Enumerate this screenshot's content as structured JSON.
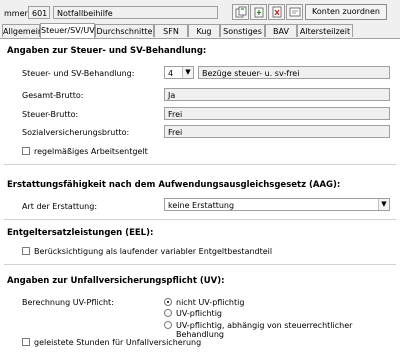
{
  "header": {
    "number_label": "mmer:",
    "number_value": "601",
    "name_value": "Notfallbeihilfe",
    "assign_button": "Konten zuordnen"
  },
  "toolbar": {
    "icons": [
      "copy-icon",
      "paste-icon",
      "delete-icon",
      "info-icon"
    ]
  },
  "tabs": [
    {
      "label": "Allgemein"
    },
    {
      "label": "Steuer/SV/UV"
    },
    {
      "label": "Durchschnitte"
    },
    {
      "label": "SFN"
    },
    {
      "label": "Kug"
    },
    {
      "label": "Sonstiges"
    },
    {
      "label": "BAV"
    },
    {
      "label": "Altersteilzeit"
    }
  ],
  "section_tax": {
    "title": "Angaben zur Steuer- und SV-Behandlung:",
    "treatment_label": "Steuer- und SV-Behandlung:",
    "treatment_code": "4",
    "treatment_text": "Bezüge steuer- u. sv-frei",
    "gross_label": "Gesamt-Brutto:",
    "gross_value": "Ja",
    "tax_gross_label": "Steuer-Brutto:",
    "tax_gross_value": "Frei",
    "sv_gross_label": "Sozialversicherungsbrutto:",
    "sv_gross_value": "Frei",
    "regular_pay_label": "regelmäßiges Arbeitsentgelt"
  },
  "section_aag": {
    "title": "Erstattungsfähigkeit nach dem Aufwendungsausgleichsgesetz (AAG):",
    "type_label": "Art der Erstattung:",
    "type_value": "keine Erstattung"
  },
  "section_eel": {
    "title": "Entgeltersatzleistungen (EEL):",
    "variable_label": "Berücksichtigung als laufender variabler Entgeltbestandteil"
  },
  "section_uv": {
    "title": "Angaben zur Unfallversicherungspflicht (UV):",
    "calc_label": "Berechnung UV-Pflicht:",
    "options": [
      "nicht UV-pflichtig",
      "UV-pflichtig",
      "UV-pflichtig, abhängig von steuerrechtlicher Behandlung"
    ],
    "selected": 0,
    "hours_label": "geleistete Stunden für Unfallversicherung"
  }
}
